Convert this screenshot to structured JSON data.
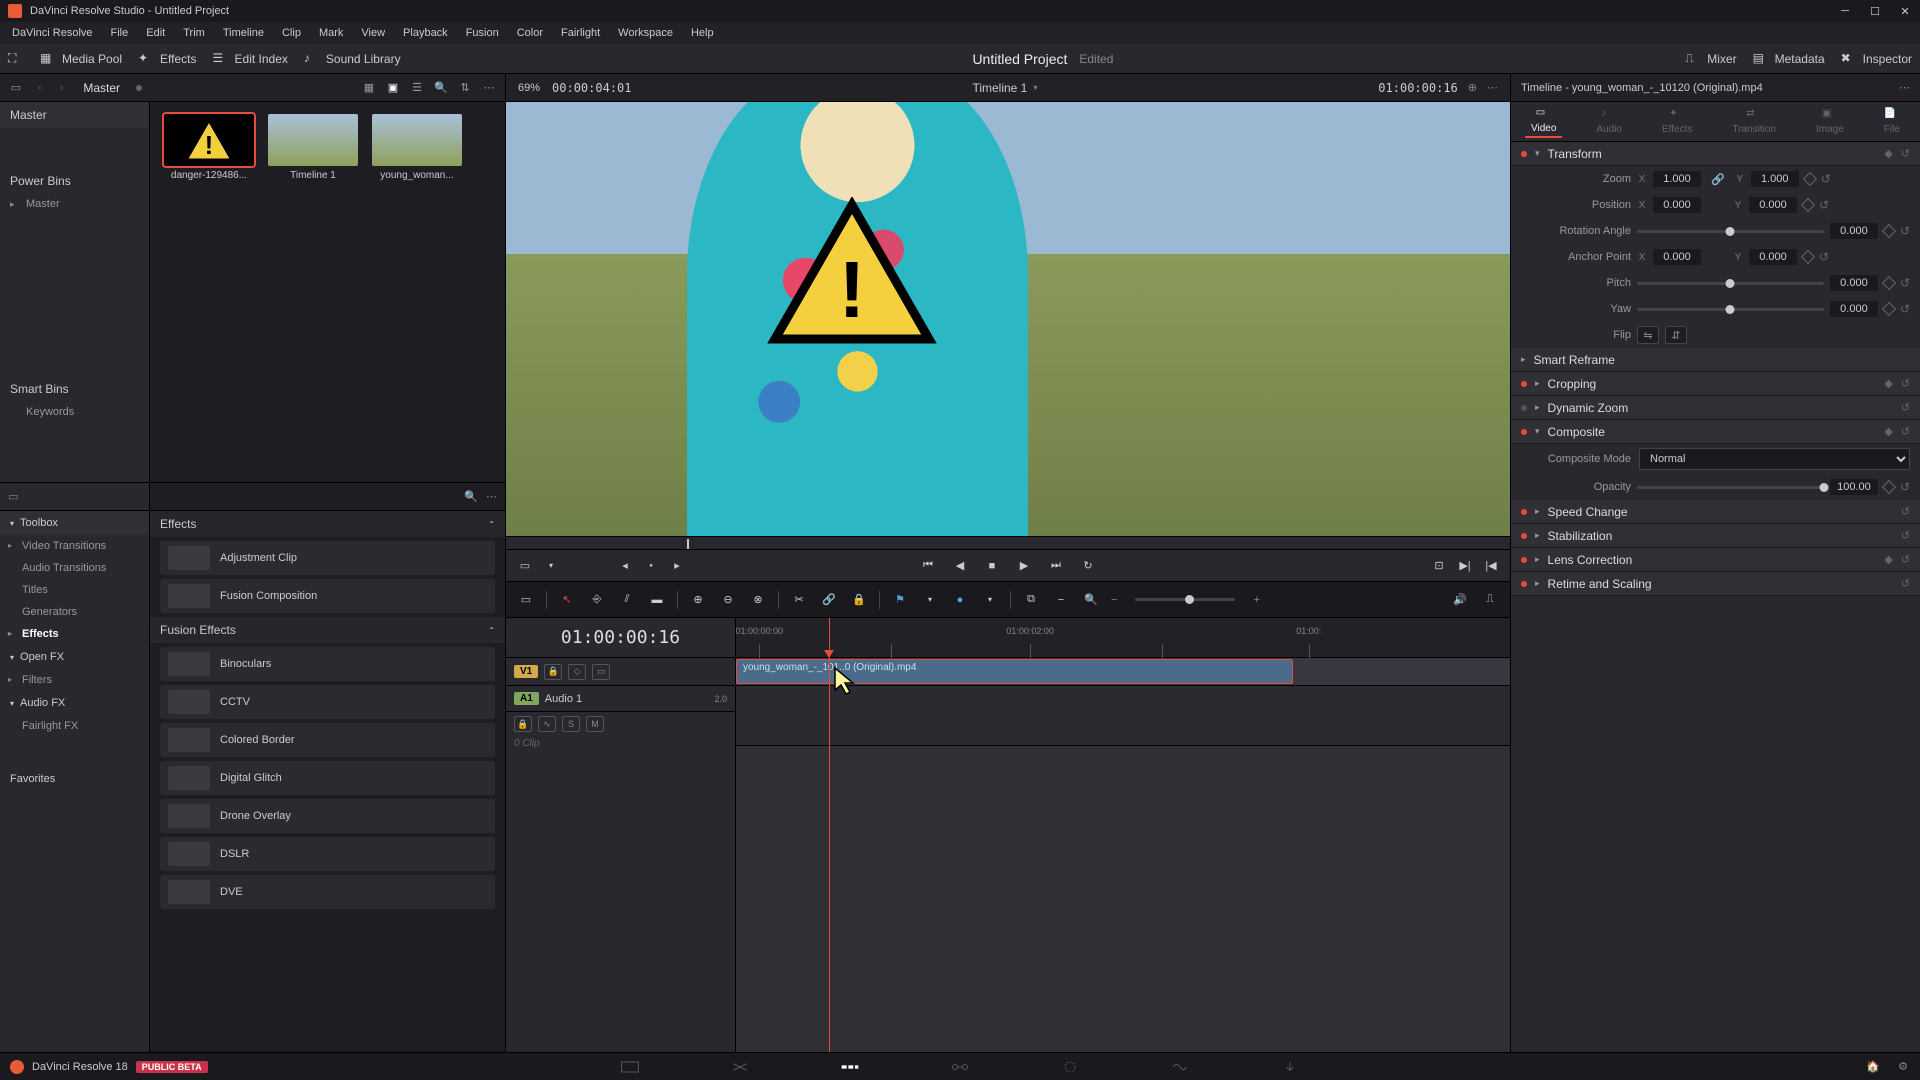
{
  "window": {
    "title": "DaVinci Resolve Studio - Untitled Project"
  },
  "menu": [
    "DaVinci Resolve",
    "File",
    "Edit",
    "Trim",
    "Timeline",
    "Clip",
    "Mark",
    "View",
    "Playback",
    "Fusion",
    "Color",
    "Fairlight",
    "Workspace",
    "Help"
  ],
  "toolbar": {
    "left": [
      {
        "id": "media-pool",
        "label": "Media Pool"
      },
      {
        "id": "effects",
        "label": "Effects"
      },
      {
        "id": "edit-index",
        "label": "Edit Index"
      },
      {
        "id": "sound-library",
        "label": "Sound Library"
      }
    ],
    "project_title": "Untitled Project",
    "project_status": "Edited",
    "right": [
      {
        "id": "mixer",
        "label": "Mixer"
      },
      {
        "id": "metadata",
        "label": "Metadata"
      },
      {
        "id": "inspector",
        "label": "Inspector"
      }
    ]
  },
  "subbar": {
    "master_label": "Master",
    "zoom_pct": "69%",
    "tc_left": "00:00:04:01",
    "timeline_name": "Timeline 1",
    "tc_right": "01:00:00:16",
    "clip_title": "Timeline - young_woman_-_10120 (Original).mp4"
  },
  "left_nav": {
    "master_header": "Master",
    "power_bins": "Power Bins",
    "power_master": "Master",
    "smart_bins": "Smart Bins",
    "keywords": "Keywords"
  },
  "media_pool": {
    "clips": [
      {
        "name": "danger-129486...",
        "selected": true,
        "warn": true
      },
      {
        "name": "Timeline 1",
        "selected": false,
        "warn": false
      },
      {
        "name": "young_woman...",
        "selected": false,
        "warn": false
      }
    ]
  },
  "effects_nav": {
    "toolbox": "Toolbox",
    "items": [
      {
        "label": "Video Transitions",
        "chev": "▸"
      },
      {
        "label": "Audio Transitions"
      },
      {
        "label": "Titles"
      },
      {
        "label": "Generators"
      },
      {
        "label": "Effects",
        "active": true,
        "chev": "▸"
      }
    ],
    "openfx": "Open FX",
    "filters": "Filters",
    "audiofx": "Audio FX",
    "fairlight": "Fairlight FX",
    "favorites": "Favorites"
  },
  "effects_panel": {
    "groups": [
      {
        "title": "Effects",
        "items": [
          {
            "name": "Adjustment Clip"
          },
          {
            "name": "Fusion Composition"
          }
        ]
      },
      {
        "title": "Fusion Effects",
        "items": [
          {
            "name": "Binoculars"
          },
          {
            "name": "CCTV"
          },
          {
            "name": "Colored Border"
          },
          {
            "name": "Digital Glitch"
          },
          {
            "name": "Drone Overlay"
          },
          {
            "name": "DSLR"
          },
          {
            "name": "DVE"
          }
        ]
      }
    ]
  },
  "timeline": {
    "tc_big": "01:00:00:16",
    "v1": "V1",
    "a1": "A1",
    "audio1": "Audio 1",
    "audio_ch": "2.0",
    "clip_label": "young_woman_-_101..0 (Original).mp4",
    "zero_clip": "0 Clip",
    "ruler": [
      "01:00:00:00",
      "01:00:02:00",
      "01:00:"
    ],
    "s_label": "S",
    "m_label": "M"
  },
  "inspector": {
    "tabs": [
      "Video",
      "Audio",
      "Effects",
      "Transition",
      "Image",
      "File"
    ],
    "active_tab": "Video",
    "transform": {
      "title": "Transform",
      "zoom": "Zoom",
      "zoom_x": "1.000",
      "zoom_y": "1.000",
      "position": "Position",
      "pos_x": "0.000",
      "pos_y": "0.000",
      "rotation": "Rotation Angle",
      "rot_val": "0.000",
      "anchor": "Anchor Point",
      "anch_x": "0.000",
      "anch_y": "0.000",
      "pitch": "Pitch",
      "pitch_val": "0.000",
      "yaw": "Yaw",
      "yaw_val": "0.000",
      "flip": "Flip"
    },
    "smart_reframe": "Smart Reframe",
    "cropping": "Cropping",
    "dynamic_zoom": "Dynamic Zoom",
    "composite": {
      "title": "Composite",
      "mode_lbl": "Composite Mode",
      "mode_val": "Normal",
      "opacity_lbl": "Opacity",
      "opacity_val": "100.00"
    },
    "speed_change": "Speed Change",
    "stabilization": "Stabilization",
    "lens_correction": "Lens Correction",
    "retime": "Retime and Scaling"
  },
  "footer": {
    "app_name": "DaVinci Resolve 18",
    "badge": "PUBLIC BETA"
  }
}
